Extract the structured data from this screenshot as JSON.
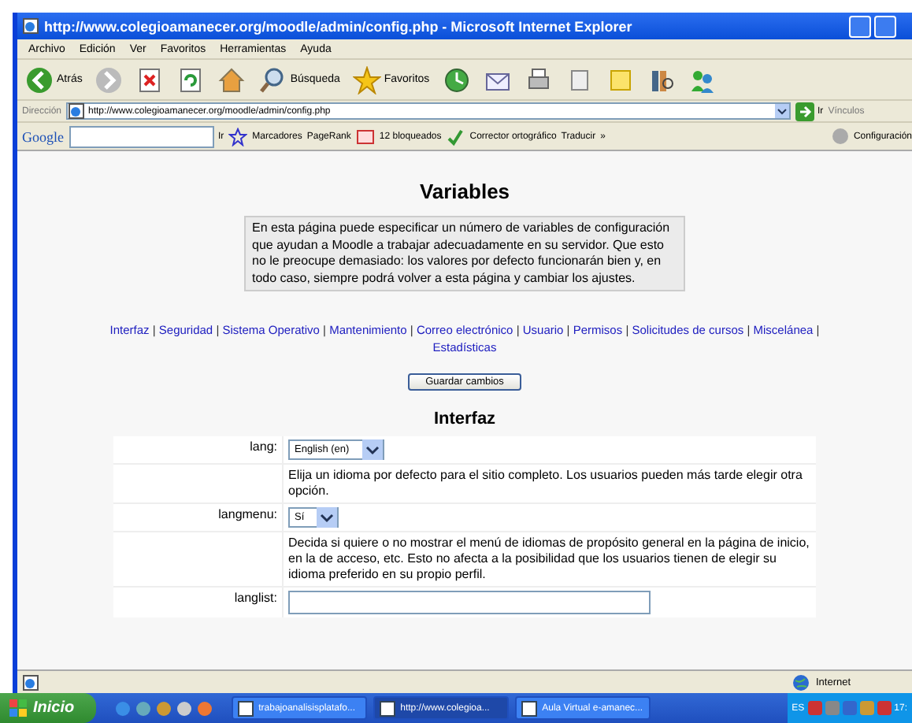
{
  "window": {
    "title": "http://www.colegioamanecer.org/moodle/admin/config.php - Microsoft Internet Explorer"
  },
  "menu": [
    "Archivo",
    "Edición",
    "Ver",
    "Favoritos",
    "Herramientas",
    "Ayuda"
  ],
  "toolbar": [
    {
      "kind": "back",
      "label": "Atrás"
    },
    {
      "kind": "forward"
    },
    {
      "kind": "stop"
    },
    {
      "kind": "refresh"
    },
    {
      "kind": "home"
    },
    {
      "kind": "search",
      "label": "Búsqueda"
    },
    {
      "kind": "favorites",
      "label": "Favoritos"
    },
    {
      "kind": "history"
    },
    {
      "kind": "mail"
    },
    {
      "kind": "print"
    },
    {
      "kind": "edit"
    },
    {
      "kind": "note"
    },
    {
      "kind": "research"
    },
    {
      "kind": "messenger"
    }
  ],
  "address": {
    "label": "Dirección",
    "value": "http://www.colegioamanecer.org/moodle/admin/config.php",
    "go": "Ir",
    "links": "Vínculos"
  },
  "google_bar": {
    "logo": "Google",
    "go": "Ir",
    "bookmarks": "Marcadores",
    "pagerank": "PageRank",
    "blocked": "12 bloqueados",
    "spell": "Corrector ortográfico",
    "translate": "Traducir",
    "more": "»",
    "settings": "Configuración"
  },
  "page": {
    "heading": "Variables",
    "intro": "En esta página puede especificar un número de variables de configuración que ayudan a Moodle a trabajar adecuadamente en su servidor. Que esto no le preocupe demasiado: los valores por defecto funcionarán bien y, en todo caso, siempre podrá volver a esta página y cambiar los ajustes.",
    "separator": "|",
    "nav": [
      "Interfaz",
      "Seguridad",
      "Sistema Operativo",
      "Mantenimiento",
      "Correo electrónico",
      "Usuario",
      "Permisos",
      "Solicitudes de cursos",
      "Miscelánea",
      "Estadísticas"
    ],
    "save": "Guardar cambios",
    "section": "Interfaz",
    "settings": [
      {
        "kind": "select",
        "name": "lang:",
        "value": "English (en)",
        "description": "Elija un idioma por defecto para el sitio completo. Los usuarios pueden más tarde elegir otra opción."
      },
      {
        "kind": "select",
        "name": "langmenu:",
        "value": "Sí",
        "description": "Decida si quiere o no mostrar el menú de idiomas de propósito general en la página de inicio, en la de acceso, etc. Esto no afecta a la posibilidad que los usuarios tienen de elegir su idioma preferido en su propio perfil."
      },
      {
        "kind": "text",
        "name": "langlist:"
      }
    ]
  },
  "status_bar": {
    "zone": "Internet"
  },
  "taskbar": {
    "start": "Inicio",
    "tasks": [
      {
        "label": "trabajoanalisisplatafo...",
        "selected": false
      },
      {
        "label": "http://www.colegioa...",
        "selected": true
      },
      {
        "label": "Aula Virtual e-amanec...",
        "selected": false
      }
    ],
    "language": "ES",
    "clock": "17:"
  }
}
